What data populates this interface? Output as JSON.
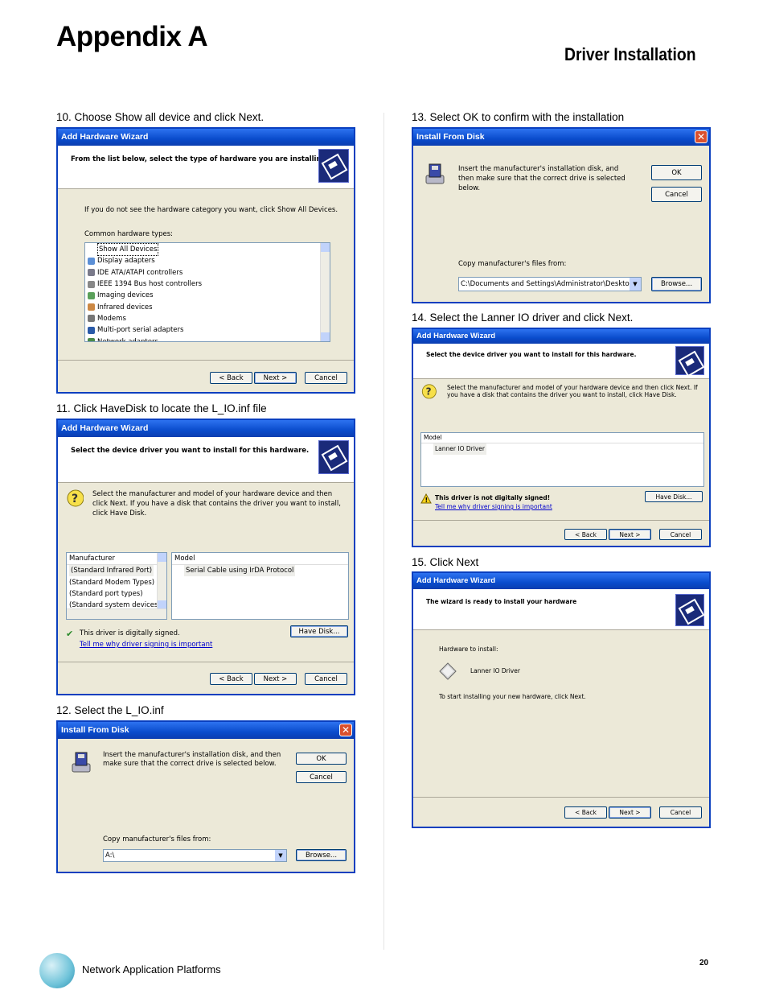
{
  "page": {
    "title": "Appendix A",
    "section": "Driver Installation",
    "footer_text": "Network Application Platforms",
    "page_number": "20"
  },
  "steps": {
    "s10": "10. Choose Show all device and click Next.",
    "s11": "11. Click HaveDisk to locate the L_IO.inf file",
    "s12": "12. Select the L_IO.inf",
    "s13": "13. Select OK to confirm with the installation",
    "s14": "14. Select the Lanner IO driver and click Next.",
    "s15": "15. Click Next"
  },
  "wizard_title": "Add Hardware Wizard",
  "install_disk_title": "Install From Disk",
  "buttons": {
    "back": "< Back",
    "next": "Next >",
    "cancel": "Cancel",
    "ok": "OK",
    "browse": "Browse...",
    "have_disk": "Have Disk..."
  },
  "dlg10": {
    "header": "From the list below, select the type of hardware you are installing",
    "hint": "If you do not see the hardware category you want, click Show All Devices.",
    "list_label": "Common hardware types:",
    "items": [
      "Show All Devices",
      "Display adapters",
      "IDE ATA/ATAPI controllers",
      "IEEE 1394 Bus host controllers",
      "Imaging devices",
      "Infrared devices",
      "Modems",
      "Multi-port serial adapters",
      "Network adapters"
    ]
  },
  "dlg11": {
    "header": "Select the device driver you want to install for this hardware.",
    "desc": "Select the manufacturer and model of your hardware device and then click Next. If you have a disk that contains the driver you want to install, click Have Disk.",
    "manufacturer_label": "Manufacturer",
    "manufacturers": [
      "(Standard Infrared Port)",
      "(Standard Modem Types)",
      "(Standard port types)",
      "(Standard system devices)"
    ],
    "model_label": "Model",
    "models": [
      "Serial Cable using IrDA Protocol"
    ],
    "signed": "This driver is digitally signed.",
    "signing_link": "Tell me why driver signing is important"
  },
  "dlg12": {
    "insert_text": "Insert the manufacturer's installation disk, and then make sure that the correct drive is selected below.",
    "copy_label": "Copy manufacturer's files from:",
    "path": "A:\\"
  },
  "dlg13": {
    "insert_text": "Insert the manufacturer's installation disk, and then make sure that the correct drive is selected below.",
    "copy_label": "Copy manufacturer's files from:",
    "path": "C:\\Documents and Settings\\Administrator\\Deskto"
  },
  "dlg14": {
    "header": "Select the device driver you want to install for this hardware.",
    "desc": "Select the manufacturer and model of your hardware device and then click Next. If you have a disk that contains the driver you want to install, click Have Disk.",
    "model_label": "Model",
    "models": [
      "Lanner IO Driver"
    ],
    "unsigned": "This driver is not digitally signed!",
    "signing_link": "Tell me why driver signing is important"
  },
  "dlg15": {
    "header": "The wizard is ready to install your hardware",
    "hw_label": "Hardware to install:",
    "hw_name": "Lanner IO Driver",
    "instruction": "To start installing your new hardware, click Next."
  }
}
